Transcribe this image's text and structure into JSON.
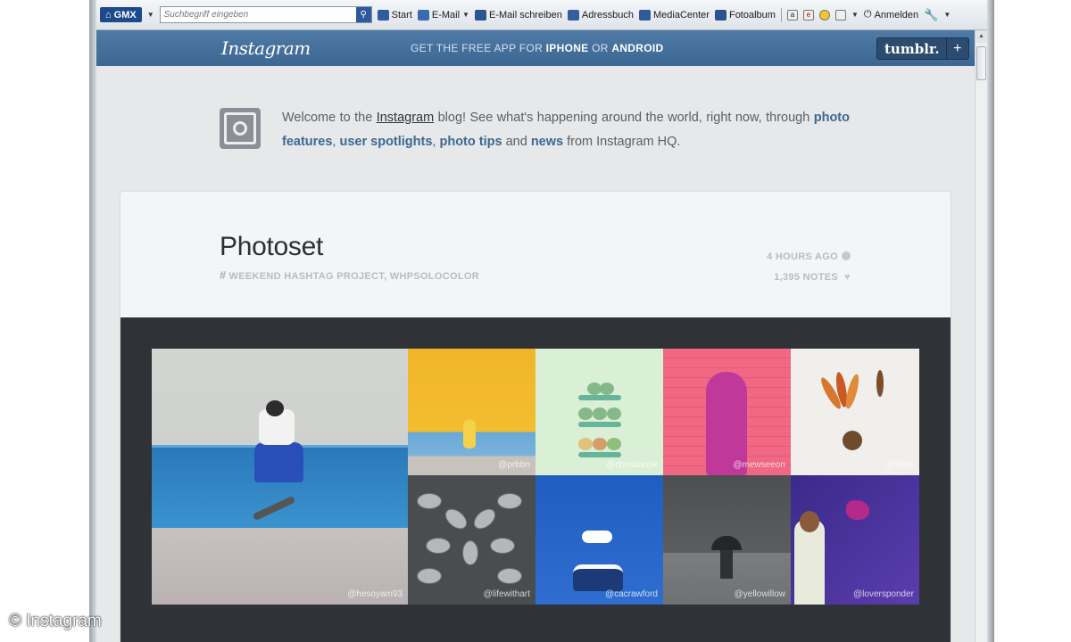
{
  "toolbar": {
    "gmx_label": "GMX",
    "search_placeholder": "Suchbegriff eingeben",
    "items": {
      "start": "Start",
      "email": "E-Mail",
      "write_email": "E-Mail schreiben",
      "addressbook": "Adressbuch",
      "mediacenter": "MediaCenter",
      "photoalbum": "Fotoalbum",
      "login": "Anmelden"
    }
  },
  "header": {
    "logo": "Instagram",
    "promo_prefix": "GET THE FREE APP FOR ",
    "promo_iphone": "IPHONE",
    "promo_or": " OR ",
    "promo_android": "ANDROID",
    "tumblr_label": "tumblr.",
    "tumblr_plus": "+"
  },
  "welcome": {
    "text_1": "Welcome to the ",
    "instagram_link": "Instagram",
    "text_2": " blog! See what's happening around the world, right now, through ",
    "link_photo_features": "photo features",
    "sep_1": ", ",
    "link_user_spotlights": "user spotlights",
    "sep_2": ", ",
    "link_photo_tips": "photo tips",
    "text_3": " and ",
    "link_news": "news",
    "text_4": " from Instagram HQ."
  },
  "post": {
    "title": "Photoset",
    "tags": "WEEKEND HASHTAG PROJECT, WHPSOLOCOLOR",
    "time": "4 HOURS AGO",
    "notes": "1,395 NOTES",
    "photos": [
      {
        "caption": "@hesoyam93"
      },
      {
        "caption": "@prbbn"
      },
      {
        "caption": "@christianak"
      },
      {
        "caption": "@mewseeon"
      },
      {
        "caption": "@fjfolo"
      },
      {
        "caption": "@lifewithart"
      },
      {
        "caption": "@cacrawford"
      },
      {
        "caption": "@yellowillow"
      },
      {
        "caption": "@loversponder"
      }
    ]
  },
  "copyright": "© Instagram",
  "colors": {
    "header_blue": "#3c6793",
    "link_blue": "#3b6891",
    "photo_bg": "#2f3236"
  }
}
